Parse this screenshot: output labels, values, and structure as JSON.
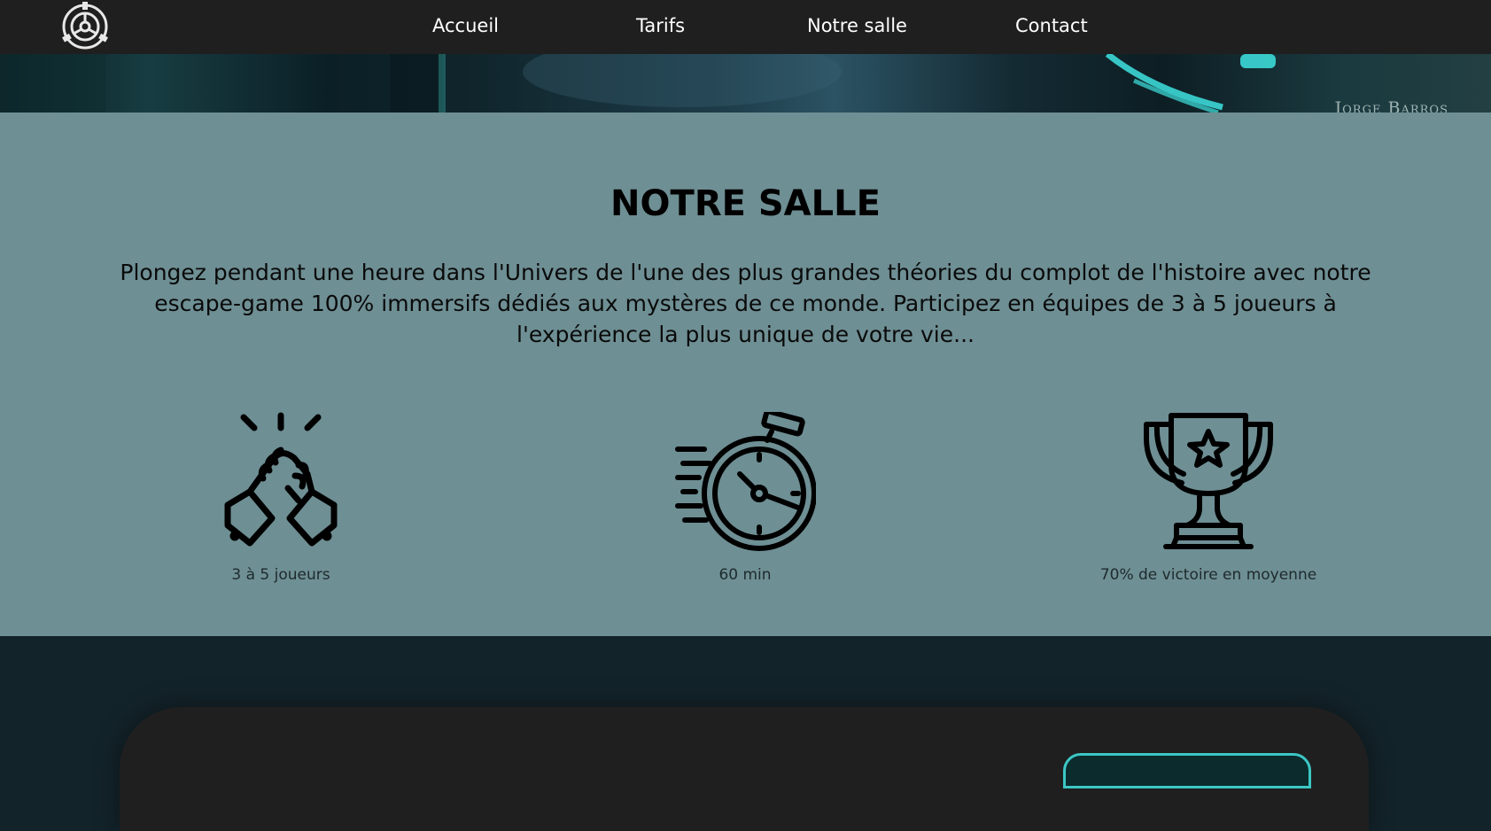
{
  "nav": {
    "logo_icon": "scp-foundation-logo",
    "links": [
      "Accueil",
      "Tarifs",
      "Notre salle",
      "Contact"
    ]
  },
  "banner": {
    "credit": "Jorge Barros"
  },
  "salle": {
    "title": "NOTRE SALLE",
    "description": "Plongez pendant une heure dans l'Univers de l'une des plus grandes théories du complot de l'histoire avec notre escape-game 100% immersifs dédiés aux mystères de ce monde. Participez en équipes de 3 à 5 joueurs à l'expérience la plus unique de votre vie...",
    "features": [
      {
        "icon": "handshake-icon",
        "label": "3 à 5 joueurs"
      },
      {
        "icon": "stopwatch-icon",
        "label": "60 min"
      },
      {
        "icon": "trophy-icon",
        "label": "70% de victoire en moyenne"
      }
    ]
  },
  "colors": {
    "nav_bg": "#1f1f1f",
    "section_bg": "#6e8f94",
    "dark_bg": "#13232a",
    "accent": "#3bc7c4"
  }
}
